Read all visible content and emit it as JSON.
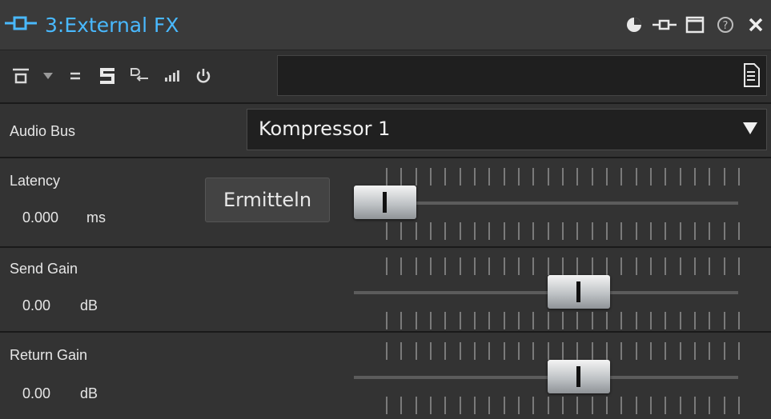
{
  "window": {
    "title": "3:External FX",
    "accent_color": "#49b9ff",
    "title_icons": [
      "plugin-connector-icon",
      "pie-icon",
      "pin-icon",
      "maximize-icon",
      "help-icon",
      "close-icon"
    ]
  },
  "toolbar": {
    "tools": [
      "bypass-icon",
      "dropdown-arrow-icon",
      "parallel-icon",
      "solo-icon",
      "routing-icon",
      "meter-icon",
      "power-icon"
    ],
    "name_field_value": "",
    "doc_icon": "document-icon"
  },
  "audio_bus": {
    "label": "Audio Bus",
    "selected": "Kompressor 1"
  },
  "latency": {
    "label": "Latency",
    "value": "0.000",
    "unit": "ms",
    "button_label": "Ermitteln",
    "slider_position": 0.0
  },
  "send_gain": {
    "label": "Send Gain",
    "value": "0.00",
    "unit": "dB",
    "slider_position": 0.66
  },
  "return_gain": {
    "label": "Return Gain",
    "value": "0.00",
    "unit": "dB",
    "slider_position": 0.66
  }
}
